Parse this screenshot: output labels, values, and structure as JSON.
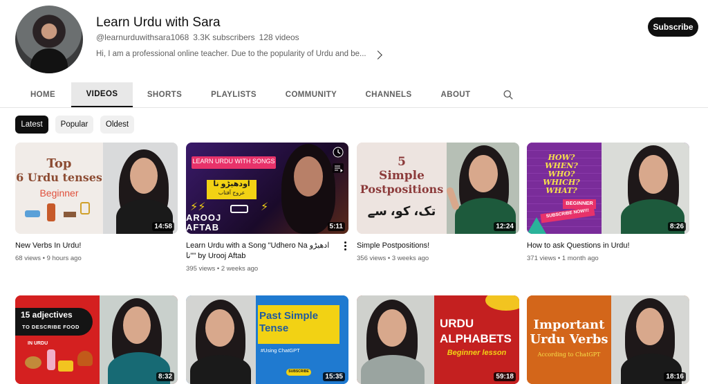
{
  "channel": {
    "name": "Learn Urdu with Sara",
    "handle": "@learnurduwithsara1068",
    "subscribers": "3.3K subscribers",
    "videos_count": "128 videos",
    "description": "Hi, I am a professional online teacher. Due to the popularity of Urdu and be...",
    "subscribe_label": "Subscribe"
  },
  "tabs": [
    "HOME",
    "VIDEOS",
    "SHORTS",
    "PLAYLISTS",
    "COMMUNITY",
    "CHANNELS",
    "ABOUT"
  ],
  "active_tab": "VIDEOS",
  "chips": [
    "Latest",
    "Popular",
    "Oldest"
  ],
  "active_chip": "Latest",
  "videos": [
    {
      "title": "New Verbs In Urdu!",
      "meta": "68 views • 9 hours ago",
      "duration": "14:58",
      "thumb_text": [
        "Top",
        "6 Urdu tenses",
        "Beginner"
      ]
    },
    {
      "title": "Learn Urdu with a Song \"Udhero Na ادھیڑو نا\"\" by Urooj Aftab",
      "meta": "395 views • 2 weeks ago",
      "duration": "5:11",
      "thumb_text": [
        "LEARN URDU WITH SONGS",
        "اودھیڑو نا",
        "عروج آفتاب",
        "AROOJ",
        "AFTAB"
      ]
    },
    {
      "title": "Simple Postpositions!",
      "meta": "356 views • 3 weeks ago",
      "duration": "12:24",
      "thumb_text": [
        "5",
        "Simple",
        "Postpositions",
        "تک، کو، سے"
      ]
    },
    {
      "title": "How to ask Questions in Urdu!",
      "meta": "371 views • 1 month ago",
      "duration": "8:26",
      "thumb_text": [
        "HOW?",
        "WHEN?",
        "WHO?",
        "WHICH?",
        "WHAT?",
        "BEGINNER",
        "SUBSCRIBE NOW!!!"
      ]
    },
    {
      "title": "",
      "meta": "",
      "duration": "8:32",
      "thumb_text": [
        "15 adjectives",
        "TO DESCRIBE FOOD",
        "IN URDU"
      ]
    },
    {
      "title": "",
      "meta": "",
      "duration": "15:35",
      "thumb_text": [
        "Past Simple",
        "Tense",
        "#Using ChatGPT",
        "SUBSCRIBE"
      ]
    },
    {
      "title": "",
      "meta": "",
      "duration": "59:18",
      "thumb_text": [
        "URDU",
        "ALPHABETS",
        "Beginner lesson"
      ]
    },
    {
      "title": "",
      "meta": "",
      "duration": "18:16",
      "thumb_text": [
        "Important",
        "Urdu Verbs",
        "According to ChatGPT"
      ]
    }
  ],
  "colors": {
    "accent": "#0f0f0f",
    "chip_bg": "#f0f0f0",
    "meta_text": "#606060"
  }
}
